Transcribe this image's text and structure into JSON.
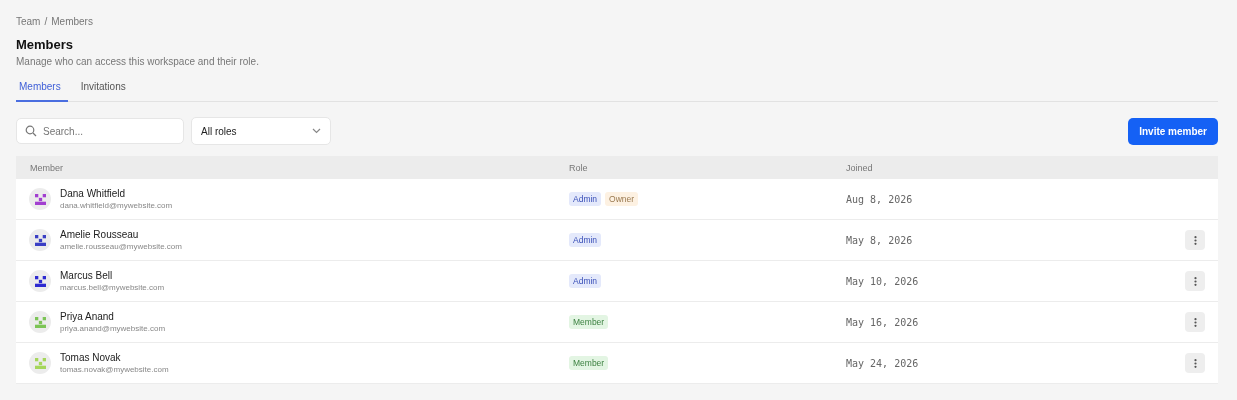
{
  "breadcrumb": {
    "parent": "Team",
    "separator": "/",
    "current": "Members"
  },
  "page": {
    "title": "Members",
    "subtitle": "Manage who can access this workspace and their role."
  },
  "tabs": [
    {
      "label": "Members",
      "selected": true
    },
    {
      "label": "Invitations",
      "selected": false
    }
  ],
  "search": {
    "placeholder": "Search..."
  },
  "role_filter": {
    "value": "All roles"
  },
  "invite_button": "Invite member",
  "table": {
    "columns": [
      "Member",
      "Role",
      "Joined"
    ],
    "rows": [
      {
        "name": "Dana Whitfield",
        "email": "dana.whitfield@mywebsite.com",
        "color": "#a23fd0",
        "roles": [
          {
            "label": "Admin",
            "kind": "admin"
          },
          {
            "label": "Owner",
            "kind": "owner"
          }
        ],
        "joined": "Aug 8, 2026",
        "has_menu": false
      },
      {
        "name": "Amelie Rousseau",
        "email": "amelie.rousseau@mywebsite.com",
        "color": "#3b3fc4",
        "roles": [
          {
            "label": "Admin",
            "kind": "admin"
          }
        ],
        "joined": "May 8, 2026",
        "has_menu": true
      },
      {
        "name": "Marcus Bell",
        "email": "marcus.bell@mywebsite.com",
        "color": "#2d2ad0",
        "roles": [
          {
            "label": "Admin",
            "kind": "admin"
          }
        ],
        "joined": "May 10, 2026",
        "has_menu": true
      },
      {
        "name": "Priya Anand",
        "email": "priya.anand@mywebsite.com",
        "color": "#7cc456",
        "roles": [
          {
            "label": "Member",
            "kind": "member"
          }
        ],
        "joined": "May 16, 2026",
        "has_menu": true
      },
      {
        "name": "Tomas Novak",
        "email": "tomas.novak@mywebsite.com",
        "color": "#a5d65a",
        "roles": [
          {
            "label": "Member",
            "kind": "member"
          }
        ],
        "joined": "May 24, 2026",
        "has_menu": true
      }
    ]
  }
}
